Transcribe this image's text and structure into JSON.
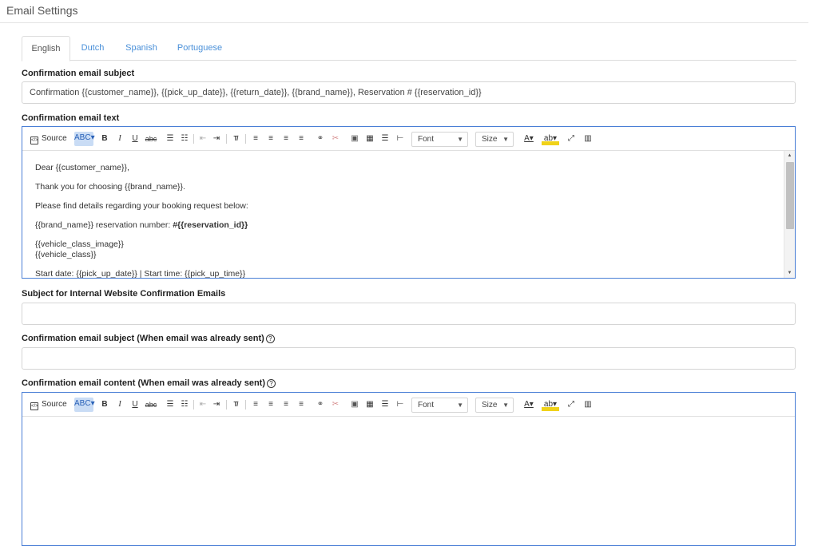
{
  "page": {
    "title": "Email Settings"
  },
  "tabs": [
    "English",
    "Dutch",
    "Spanish",
    "Portuguese"
  ],
  "fields": {
    "subject_label": "Confirmation email subject",
    "subject_value": "Confirmation {{customer_name}}, {{pick_up_date}}, {{return_date}}, {{brand_name}}, Reservation # {{reservation_id}}",
    "text_label": "Confirmation email text",
    "internal_subject_label": "Subject for Internal Website Confirmation Emails",
    "internal_subject_value": "",
    "already_sent_subject_label": "Confirmation email subject (When email was already sent)",
    "already_sent_subject_value": "",
    "already_sent_content_label": "Confirmation email content (When email was already sent)"
  },
  "toolbar": {
    "source": "Source",
    "bold": "B",
    "italic": "I",
    "underline": "U",
    "strike": "abc",
    "font": "Font",
    "size": "Size",
    "spell": "ABC"
  },
  "email_body": {
    "line1": "Dear {{customer_name}},",
    "line2": "Thank you for choosing {{brand_name}}.",
    "line3": "Please find details regarding your booking request below:",
    "line4_prefix": "{{brand_name}} reservation number: ",
    "line4_bold": "#{{reservation_id}}",
    "line5": "{{vehicle_class_image}}",
    "line6": "{{vehicle_class}}",
    "line7": "Start date: {{pick_up_date}} | Start time: {{pick_up_time}}"
  },
  "icons": [
    "help-icon",
    "source-icon",
    "spellcheck-icon",
    "bold-icon",
    "italic-icon",
    "underline-icon",
    "strikethrough-icon",
    "numbered-list-icon",
    "bulleted-list-icon",
    "outdent-icon",
    "indent-icon",
    "remove-format-icon",
    "align-left-icon",
    "align-center-icon",
    "align-right-icon",
    "align-justify-icon",
    "link-icon",
    "unlink-icon",
    "image-icon",
    "table-icon",
    "horizontal-rule-icon",
    "page-break-icon",
    "text-color-icon",
    "background-color-icon",
    "maximize-icon",
    "show-blocks-icon"
  ],
  "colors": {
    "accent": "#4a7fd6",
    "tab_link": "#4a90d9",
    "spell_bg": "#c9dcf5"
  }
}
